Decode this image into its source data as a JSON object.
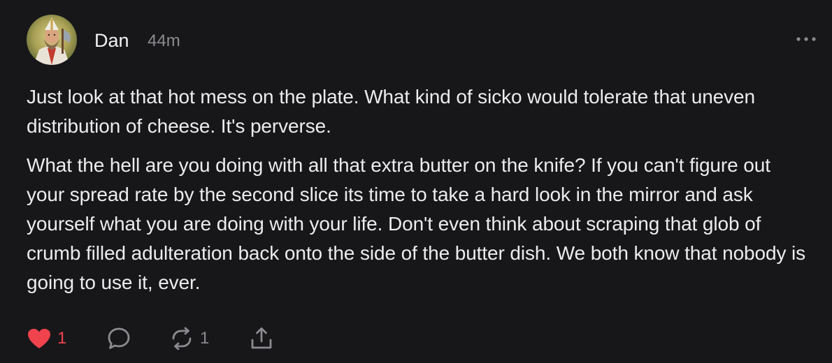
{
  "post": {
    "author": "Dan",
    "time": "44m",
    "paragraphs": [
      "Just look at that hot mess on the plate. What kind of sicko would tolerate that uneven distribution of cheese. It's perverse.",
      "What the hell are you doing with all that extra butter on the knife? If you can't figure out your spread rate by the second slice its time to take a hard look in the mirror and ask yourself what you are doing with your life. Don't even think about scraping that glob of crumb filled adulteration back onto the side of the butter dish. We both know that nobody is going to use it, ever."
    ],
    "likes": "1",
    "reposts": "1",
    "liked": true
  },
  "icons": {
    "more": "more-horizontal-icon",
    "like": "heart-filled-icon",
    "reply": "speech-bubble-icon",
    "repost": "repost-arrows-icon",
    "share": "share-upload-icon"
  },
  "colors": {
    "background": "#171719",
    "text": "#ececef",
    "muted": "#8b8b90",
    "like": "#f0434e"
  }
}
